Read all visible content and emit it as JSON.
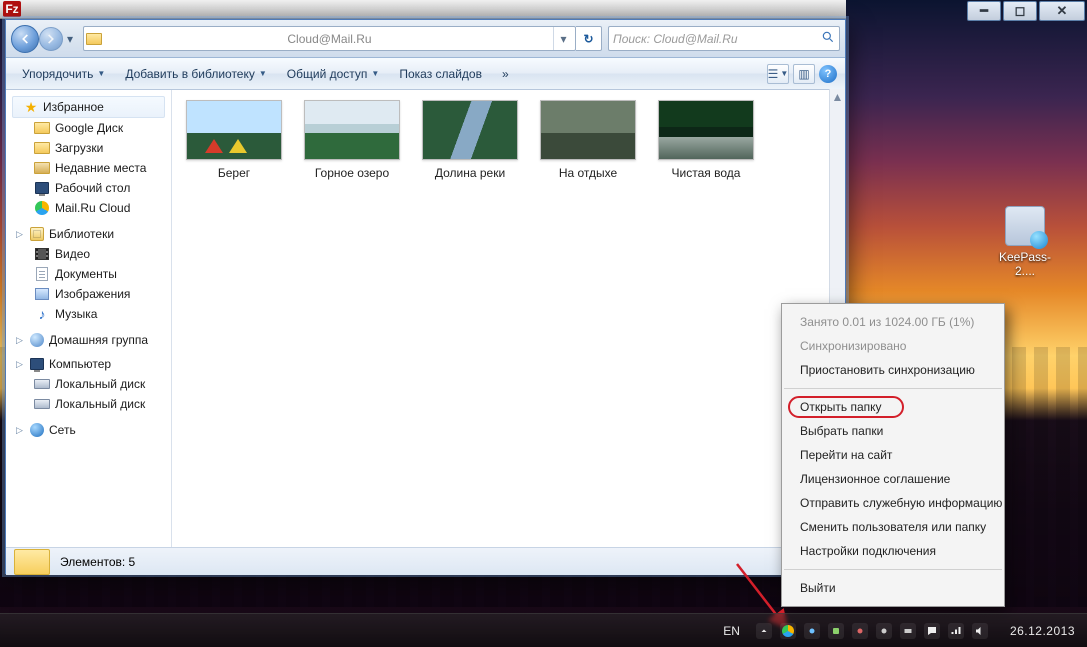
{
  "address": {
    "path": "Cloud@Mail.Ru",
    "search_placeholder": "Поиск: Cloud@Mail.Ru"
  },
  "toolbar": {
    "organize": "Упорядочить",
    "add_library": "Добавить в библиотеку",
    "share": "Общий доступ",
    "slideshow": "Показ слайдов",
    "more": "»"
  },
  "tree": {
    "favorites": {
      "title": "Избранное",
      "items": [
        "Google Диск",
        "Загрузки",
        "Недавние места",
        "Рабочий стол",
        "Mail.Ru Cloud"
      ]
    },
    "libraries": {
      "title": "Библиотеки",
      "items": [
        "Видео",
        "Документы",
        "Изображения",
        "Музыка"
      ]
    },
    "homegroup": "Домашняя группа",
    "computer": {
      "title": "Компьютер",
      "items": [
        "Локальный диск",
        "Локальный диск"
      ]
    },
    "network": "Сеть"
  },
  "thumbs": [
    "Берег",
    "Горное озеро",
    "Долина реки",
    "На отдыхе",
    "Чистая вода"
  ],
  "status": {
    "text": "Элементов: 5"
  },
  "desktop": {
    "keepass": "KeePass-2...."
  },
  "ctx": {
    "usage": "Занято 0.01 из 1024.00 ГБ (1%)",
    "synced": "Синхронизировано",
    "pause": "Приостановить синхронизацию",
    "open": "Открыть папку",
    "choose": "Выбрать папки",
    "site": "Перейти на сайт",
    "license": "Лицензионное соглашение",
    "diag": "Отправить служебную информацию",
    "change": "Сменить пользователя или папку",
    "settings": "Настройки подключения",
    "exit": "Выйти"
  },
  "taskbar": {
    "lang": "EN",
    "date": "26.12.2013"
  }
}
